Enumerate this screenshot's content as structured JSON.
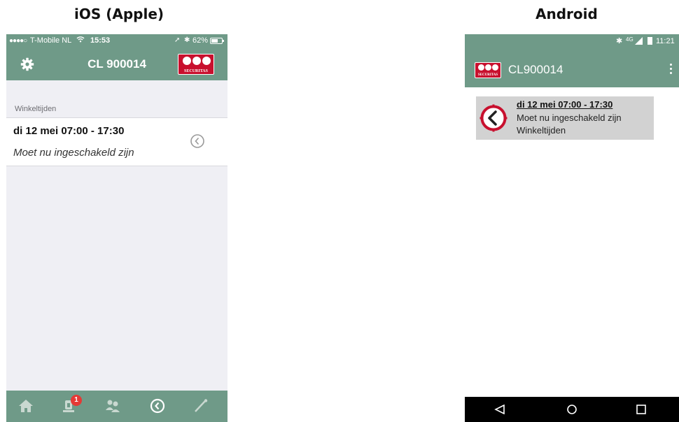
{
  "headings": {
    "ios": "iOS (Apple)",
    "android": "Android"
  },
  "colors": {
    "bar_green": "#6f9a88",
    "brand_red": "#c8102e",
    "badge_red": "#e53935",
    "nav_black": "#000000"
  },
  "ios": {
    "status": {
      "signal": "●●●●○",
      "carrier": "T-Mobile NL",
      "wifi_icon": "wifi-icon",
      "time": "15:53",
      "battery": "62%"
    },
    "nav": {
      "title": "CL 900014",
      "left_icon": "gear-icon",
      "logo": "securitas-logo",
      "logo_text": "SECURITAS"
    },
    "section_header": "Winkeltijden",
    "item": {
      "line1": "di 12 mei 07:00 - 17:30",
      "line2": "Moet nu ingeschakeld zijn",
      "icon": "clock-icon"
    },
    "tabs": [
      {
        "icon": "home-icon"
      },
      {
        "icon": "alarm-icon",
        "badge": "1"
      },
      {
        "icon": "users-icon"
      },
      {
        "icon": "clock-icon",
        "selected": true
      },
      {
        "icon": "key-icon"
      }
    ]
  },
  "android": {
    "status": {
      "bluetooth_icon": "bluetooth-icon",
      "network": "4G",
      "time": "11:21"
    },
    "toolbar": {
      "title": "CL900014",
      "logo": "securitas-logo",
      "logo_text": "SECURITAS",
      "menu_icon": "overflow-menu-icon"
    },
    "item": {
      "line1": "di 12 mei 07:00 - 17:30",
      "line2": "Moet nu ingeschakeld zijn",
      "line3": "Winkeltijden",
      "icon": "clock-icon"
    },
    "nav": [
      {
        "icon": "back-icon"
      },
      {
        "icon": "home-icon"
      },
      {
        "icon": "recents-icon"
      }
    ]
  }
}
